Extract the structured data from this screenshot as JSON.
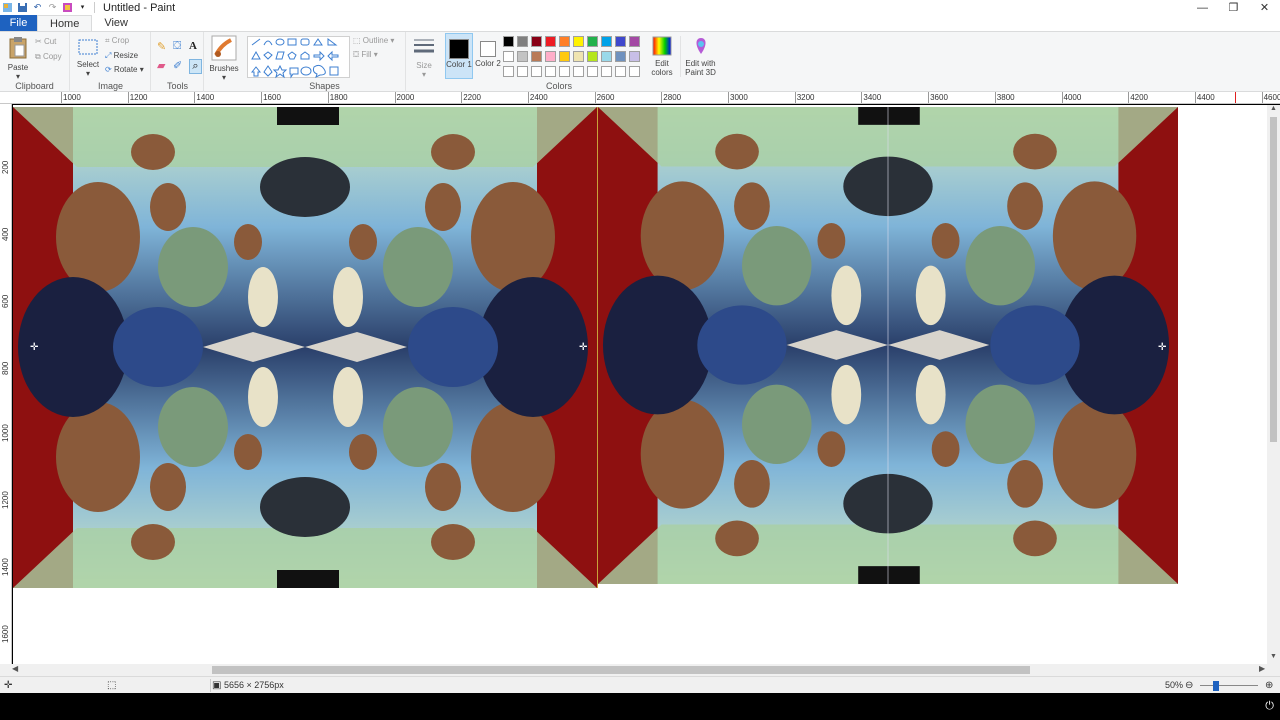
{
  "window": {
    "title": "Untitled - Paint",
    "controls": [
      "—",
      "❐",
      "✕"
    ]
  },
  "tabs": [
    "File",
    "Home",
    "View"
  ],
  "ribbon": {
    "clipboard": {
      "label": "Clipboard",
      "paste": "Paste",
      "cut": "Cut",
      "copy": "Copy"
    },
    "image": {
      "label": "Image",
      "select": "Select",
      "crop": "Crop",
      "resize": "Resize",
      "rotate": "Rotate"
    },
    "tools": {
      "label": "Tools"
    },
    "brushes": {
      "label": "Brushes"
    },
    "shapes": {
      "label": "Shapes",
      "outline": "Outline",
      "fill": "Fill"
    },
    "size": {
      "label": "Size"
    },
    "colors": {
      "label": "Colors",
      "color1": "Color 1",
      "color2": "Color 2",
      "edit_colors": "Edit colors",
      "paint3d": "Edit with Paint 3D",
      "palette_row1": [
        "#000000",
        "#7f7f7f",
        "#880015",
        "#ed1c24",
        "#ff7f27",
        "#fff200",
        "#22b14c",
        "#00a2e8",
        "#3f48cc",
        "#a349a4"
      ],
      "palette_row2": [
        "#ffffff",
        "#c3c3c3",
        "#b97a57",
        "#ffaec9",
        "#ffc90e",
        "#efe4b0",
        "#b5e61d",
        "#99d9ea",
        "#7092be",
        "#c8bfe7"
      ],
      "palette_row3": [
        "#ffffff",
        "#ffffff",
        "#ffffff",
        "#ffffff",
        "#ffffff",
        "#ffffff",
        "#ffffff",
        "#ffffff",
        "#ffffff",
        "#ffffff"
      ]
    }
  },
  "ruler": {
    "top_ticks": [
      "1000",
      "1200",
      "1400",
      "1600",
      "1800",
      "2000",
      "2200",
      "2400",
      "2600",
      "2800",
      "3000",
      "3200",
      "3400",
      "3600",
      "3800",
      "4000",
      "4200",
      "4400",
      "4600"
    ],
    "left_ticks": [
      "200",
      "400",
      "600",
      "800",
      "1000",
      "1200",
      "1400",
      "1600"
    ]
  },
  "status": {
    "image_size": "5656 × 2756px",
    "zoom": "50%"
  }
}
